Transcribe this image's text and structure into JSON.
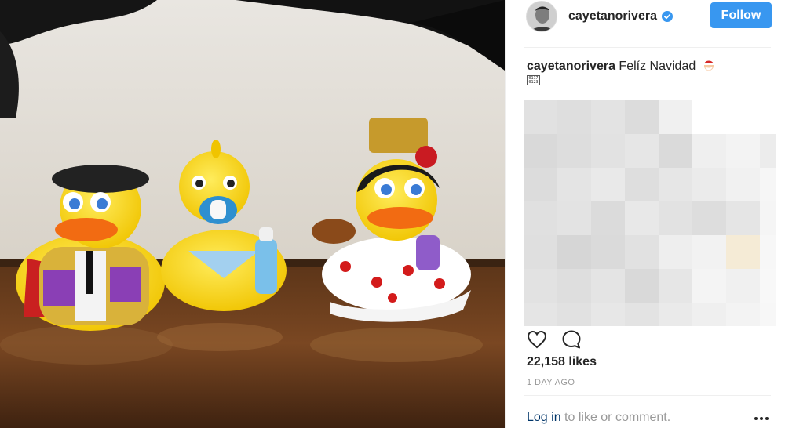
{
  "post": {
    "username": "cayetanorivera",
    "verified": true,
    "follow_label": "Follow",
    "caption_author": "cayetanorivera",
    "caption_text": "Felíz Navidad",
    "caption_emoji": "santa-emoji",
    "likes": "22,158 likes",
    "timestamp": "1 DAY AGO",
    "login_link": "Log in",
    "login_suffix": " to like or comment.",
    "photo_description_icon": "rubber-ducks-photo"
  },
  "colors": {
    "follow_button": "#3897f0",
    "verified_badge": "#3897f0",
    "muted_text": "#999999",
    "link_text": "#003569"
  },
  "icons": [
    "heart-icon",
    "comment-icon",
    "more-options-icon",
    "verified-icon",
    "santa-emoji"
  ]
}
